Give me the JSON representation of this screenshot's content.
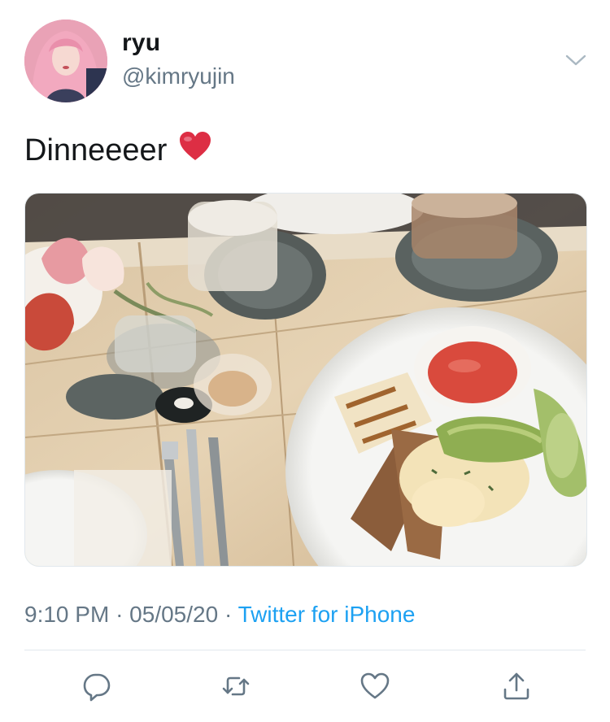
{
  "author": {
    "display_name": "ryu",
    "handle": "@kimryujin"
  },
  "tweet": {
    "text": "Dinneeeer",
    "emoji": "heart-emoji"
  },
  "meta": {
    "time": "9:10 PM",
    "date": "05/05/20",
    "separator": "·",
    "source": "Twitter for iPhone"
  },
  "icons": {
    "menu": "chevron-down-icon",
    "reply": "reply-icon",
    "retweet": "retweet-icon",
    "like": "like-icon",
    "share": "share-icon"
  },
  "colors": {
    "link": "#1da1f2",
    "secondary_text": "#657786",
    "divider": "#e1e8ed",
    "heart": "#e0245e"
  }
}
